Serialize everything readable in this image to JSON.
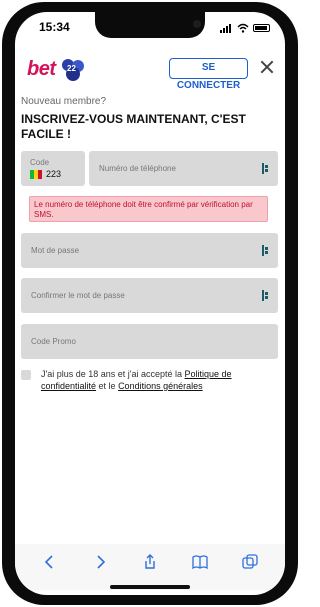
{
  "status_bar": {
    "time": "15:34"
  },
  "header": {
    "logo_text": "bet",
    "connect_label": "SE CONNECTER"
  },
  "form": {
    "subtitle": "Nouveau membre?",
    "title": "INSCRIVEZ-VOUS MAINTENANT, C'EST FACILE !",
    "code_label": "Code",
    "code_value": "223",
    "phone_placeholder": "Numéro de téléphone",
    "error_message": "Le numéro de téléphone doit être confirmé par vérification par SMS.",
    "password_placeholder": "Mot de passe",
    "confirm_password_placeholder": "Confirmer le mot de passe",
    "promo_placeholder": "Code Promo",
    "consent": {
      "text_before": "J'ai plus de 18 ans et j'ai accepté la ",
      "link_privacy": "Politique de confidentialité",
      "text_middle": " et le ",
      "link_terms": "Conditions générales"
    }
  },
  "colors": {
    "brand": "#d4145a",
    "accent": "#1d5fcf",
    "field": "#d9d9d9",
    "error_bg": "#f8c8cc",
    "error_text": "#c01030"
  },
  "icons": [
    "close-icon",
    "eye-toggle-icon",
    "back-icon",
    "forward-icon",
    "share-icon",
    "bookmarks-icon",
    "tabs-icon"
  ]
}
